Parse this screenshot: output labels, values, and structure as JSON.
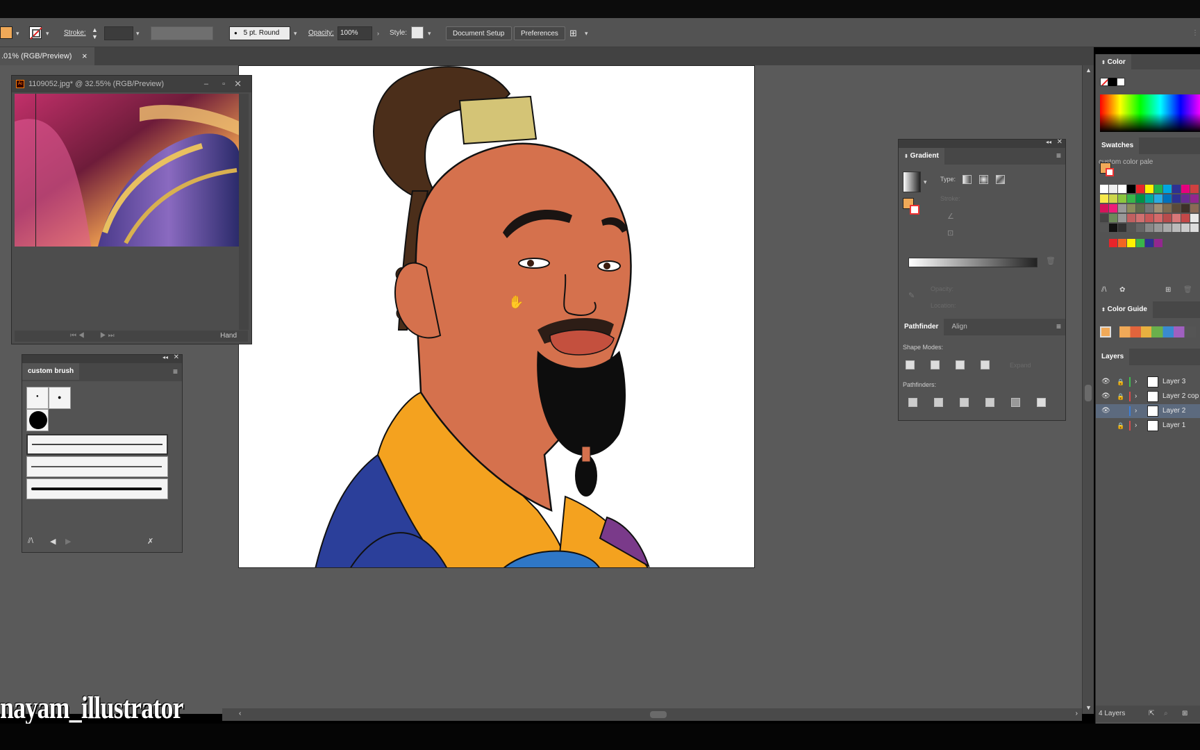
{
  "control_bar": {
    "stroke_label": "Stroke:",
    "brush_preset": "5 pt. Round",
    "opacity_label": "Opacity:",
    "opacity_value": "100%",
    "style_label": "Style:",
    "document_setup": "Document Setup",
    "preferences": "Preferences",
    "fill_color": "#f0a958"
  },
  "document_tab": {
    "title": ".01% (RGB/Preview)",
    "close": "×"
  },
  "reference_window": {
    "title": "1109052.jpg* @ 32.55% (RGB/Preview)",
    "status_tool": "Hand"
  },
  "brush_panel": {
    "title": "custom brush"
  },
  "gradient_panel": {
    "title": "Gradient",
    "type_label": "Type:",
    "stroke_label": "Stroke:",
    "opacity_label": "Opacity:",
    "location_label": "Location:",
    "pathfinder_tab": "Pathfinder",
    "align_tab": "Align",
    "shape_modes_label": "Shape Modes:",
    "expand_label": "Expand",
    "pathfinders_label": "Pathfinders:"
  },
  "right_dock": {
    "color_title": "Color",
    "swatches_tab": "Swatches",
    "custom_palette_tab": "custom color pale",
    "color_guide_title": "Color Guide",
    "layers_title": "Layers",
    "layers": [
      {
        "name": "Layer 3",
        "color": "#3fbf4f",
        "visible": true,
        "locked": true
      },
      {
        "name": "Layer 2 cop",
        "color": "#e04848",
        "visible": true,
        "locked": true
      },
      {
        "name": "Layer 2",
        "color": "#3c7fd8",
        "visible": true,
        "locked": false,
        "selected": true
      },
      {
        "name": "Layer 1",
        "color": "#d84c4c",
        "visible": false,
        "locked": true
      }
    ],
    "layers_count": "4 Layers"
  },
  "watermark": "nayam_illustrator"
}
